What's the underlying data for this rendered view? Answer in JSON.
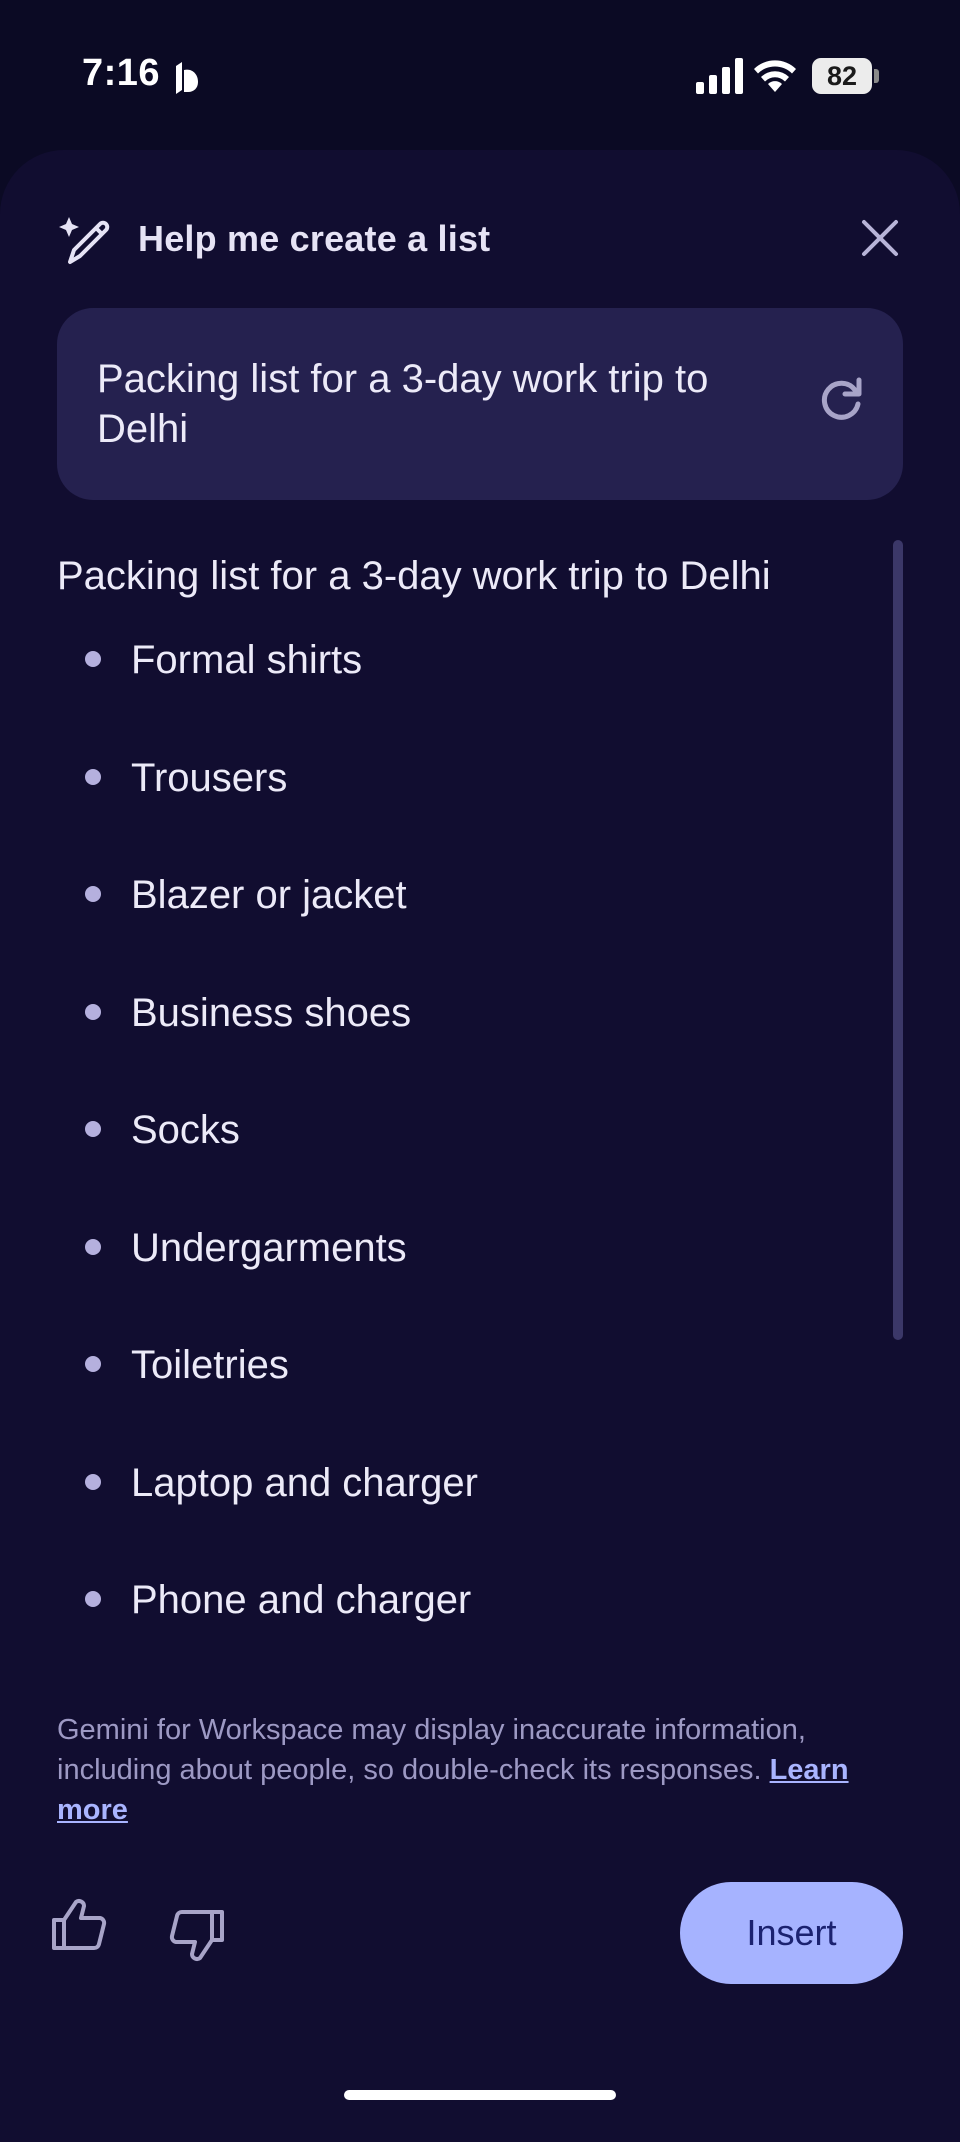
{
  "status_bar": {
    "time": "7:16",
    "battery_level": "82",
    "icons": [
      "do-not-disturb-icon",
      "cellular-signal-icon",
      "wifi-icon",
      "battery-icon"
    ]
  },
  "sheet": {
    "header": {
      "icon": "magic-pen-icon",
      "title": "Help me create a list",
      "close_icon": "close-icon"
    },
    "prompt": {
      "text": "Packing list for a 3-day work trip to Delhi",
      "refresh_icon": "refresh-icon"
    },
    "result": {
      "title": "Packing list for a 3-day work trip to Delhi",
      "items": [
        "Formal shirts",
        "Trousers",
        "Blazer or jacket",
        "Business shoes",
        "Socks",
        "Undergarments",
        "Toiletries",
        "Laptop and charger",
        "Phone and charger"
      ]
    },
    "disclaimer": {
      "text": "Gemini for Workspace may display inaccurate information, including about people, so double-check its responses. ",
      "link_label": "Learn more"
    },
    "actions": {
      "thumbs_up_icon": "thumbs-up-icon",
      "thumbs_down_icon": "thumbs-down-icon",
      "insert_label": "Insert"
    }
  },
  "colors": {
    "background": "#0b0a24",
    "sheet": "#110d30",
    "prompt_card": "#25214f",
    "accent": "#a6b3ff",
    "link": "#a9b4ff"
  }
}
